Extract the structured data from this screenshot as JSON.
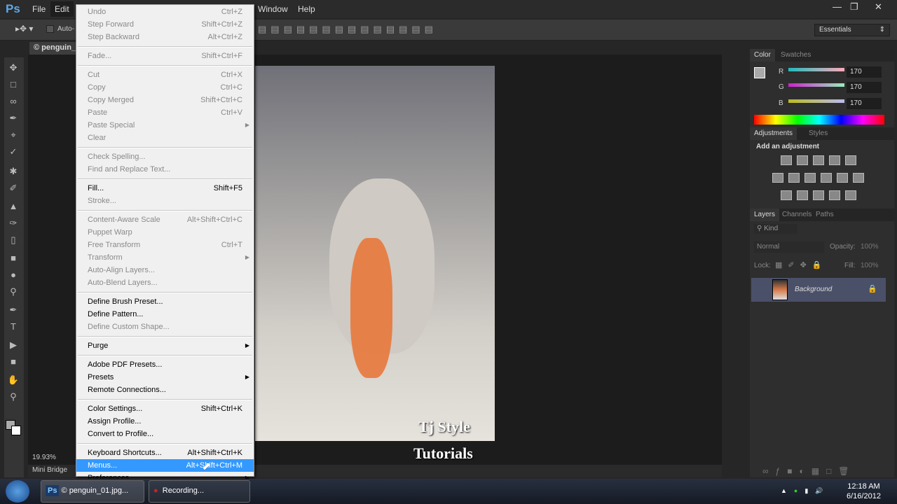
{
  "app": {
    "logo": "Ps",
    "menus": [
      "File",
      "Edit",
      "Window",
      "Help"
    ],
    "workspace": "Essentials",
    "option_checkbox": "Auto-",
    "window_controls": [
      "minimize-icon",
      "restore-icon",
      "close-icon"
    ]
  },
  "document": {
    "tab": "© penguin_",
    "zoom": "19.93%",
    "mini_bridge": "Mini Bridge",
    "watermark_line1": "Tj Style",
    "watermark_line2": "Tutorials"
  },
  "color_panel": {
    "tabs": [
      "Color",
      "Swatches"
    ],
    "channels": [
      {
        "label": "R",
        "value": "170"
      },
      {
        "label": "G",
        "value": "170"
      },
      {
        "label": "B",
        "value": "170"
      }
    ],
    "slider_fraction": 0.667
  },
  "adjustments_panel": {
    "tabs": [
      "Adjustments",
      "Styles"
    ],
    "heading": "Add an adjustment"
  },
  "layers_panel": {
    "tabs": [
      "Layers",
      "Channels",
      "Paths"
    ],
    "filter": "Kind",
    "blend_mode": "Normal",
    "opacity_label": "Opacity:",
    "opacity": "100%",
    "lock_label": "Lock:",
    "fill_label": "Fill:",
    "fill": "100%",
    "layers": [
      {
        "name": "Background",
        "locked": true,
        "visible": true
      }
    ]
  },
  "edit_menu": [
    {
      "label": "Undo",
      "shortcut": "Ctrl+Z",
      "disabled": true
    },
    {
      "label": "Step Forward",
      "shortcut": "Shift+Ctrl+Z",
      "disabled": true
    },
    {
      "label": "Step Backward",
      "shortcut": "Alt+Ctrl+Z",
      "disabled": true
    },
    {
      "sep": true
    },
    {
      "label": "Fade...",
      "shortcut": "Shift+Ctrl+F",
      "disabled": true
    },
    {
      "sep": true
    },
    {
      "label": "Cut",
      "shortcut": "Ctrl+X",
      "disabled": true
    },
    {
      "label": "Copy",
      "shortcut": "Ctrl+C",
      "disabled": true
    },
    {
      "label": "Copy Merged",
      "shortcut": "Shift+Ctrl+C",
      "disabled": true
    },
    {
      "label": "Paste",
      "shortcut": "Ctrl+V",
      "disabled": true
    },
    {
      "label": "Paste Special",
      "submenu": true,
      "disabled": true
    },
    {
      "label": "Clear",
      "disabled": true
    },
    {
      "sep": true
    },
    {
      "label": "Check Spelling...",
      "disabled": true
    },
    {
      "label": "Find and Replace Text...",
      "disabled": true
    },
    {
      "sep": true
    },
    {
      "label": "Fill...",
      "shortcut": "Shift+F5"
    },
    {
      "label": "Stroke...",
      "disabled": true
    },
    {
      "sep": true
    },
    {
      "label": "Content-Aware Scale",
      "shortcut": "Alt+Shift+Ctrl+C",
      "disabled": true
    },
    {
      "label": "Puppet Warp",
      "disabled": true
    },
    {
      "label": "Free Transform",
      "shortcut": "Ctrl+T",
      "disabled": true
    },
    {
      "label": "Transform",
      "submenu": true,
      "disabled": true
    },
    {
      "label": "Auto-Align Layers...",
      "disabled": true
    },
    {
      "label": "Auto-Blend Layers...",
      "disabled": true
    },
    {
      "sep": true
    },
    {
      "label": "Define Brush Preset..."
    },
    {
      "label": "Define Pattern..."
    },
    {
      "label": "Define Custom Shape...",
      "disabled": true
    },
    {
      "sep": true
    },
    {
      "label": "Purge",
      "submenu": true
    },
    {
      "sep": true
    },
    {
      "label": "Adobe PDF Presets..."
    },
    {
      "label": "Presets",
      "submenu": true
    },
    {
      "label": "Remote Connections..."
    },
    {
      "sep": true
    },
    {
      "label": "Color Settings...",
      "shortcut": "Shift+Ctrl+K"
    },
    {
      "label": "Assign Profile..."
    },
    {
      "label": "Convert to Profile..."
    },
    {
      "sep": true
    },
    {
      "label": "Keyboard Shortcuts...",
      "shortcut": "Alt+Shift+Ctrl+K"
    },
    {
      "label": "Menus...",
      "shortcut": "Alt+Shift+Ctrl+M",
      "highlighted": true
    },
    {
      "label": "Preferences",
      "submenu": true
    }
  ],
  "taskbar": {
    "items": [
      "© penguin_01.jpg...",
      "Recording..."
    ],
    "time": "12:18 AM",
    "date": "6/16/2012"
  },
  "colors": {
    "highlight": "#3399ff",
    "layer_selected": "#4a5068"
  }
}
